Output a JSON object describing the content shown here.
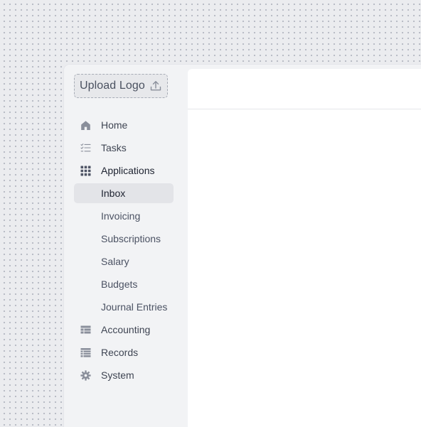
{
  "upload": {
    "label": "Upload Logo",
    "icon": "upload-icon"
  },
  "nav": {
    "home": {
      "label": "Home",
      "icon": "home-icon"
    },
    "tasks": {
      "label": "Tasks",
      "icon": "tasks-icon"
    },
    "applications": {
      "label": "Applications",
      "icon": "grid-icon"
    },
    "inbox": {
      "label": "Inbox",
      "active": true
    },
    "invoicing": {
      "label": "Invoicing"
    },
    "subscriptions": {
      "label": "Subscriptions"
    },
    "salary": {
      "label": "Salary"
    },
    "budgets": {
      "label": "Budgets"
    },
    "journal_entries": {
      "label": "Journal Entries"
    },
    "accounting": {
      "label": "Accounting",
      "icon": "table-icon"
    },
    "records": {
      "label": "Records",
      "icon": "records-icon"
    },
    "system": {
      "label": "System",
      "icon": "gear-icon"
    }
  },
  "colors": {
    "background": "#ebecef",
    "sidebar": "#f2f3f5",
    "active_item": "#e3e4e8",
    "icon": "#8a8f9b",
    "text": "#3f4553"
  }
}
